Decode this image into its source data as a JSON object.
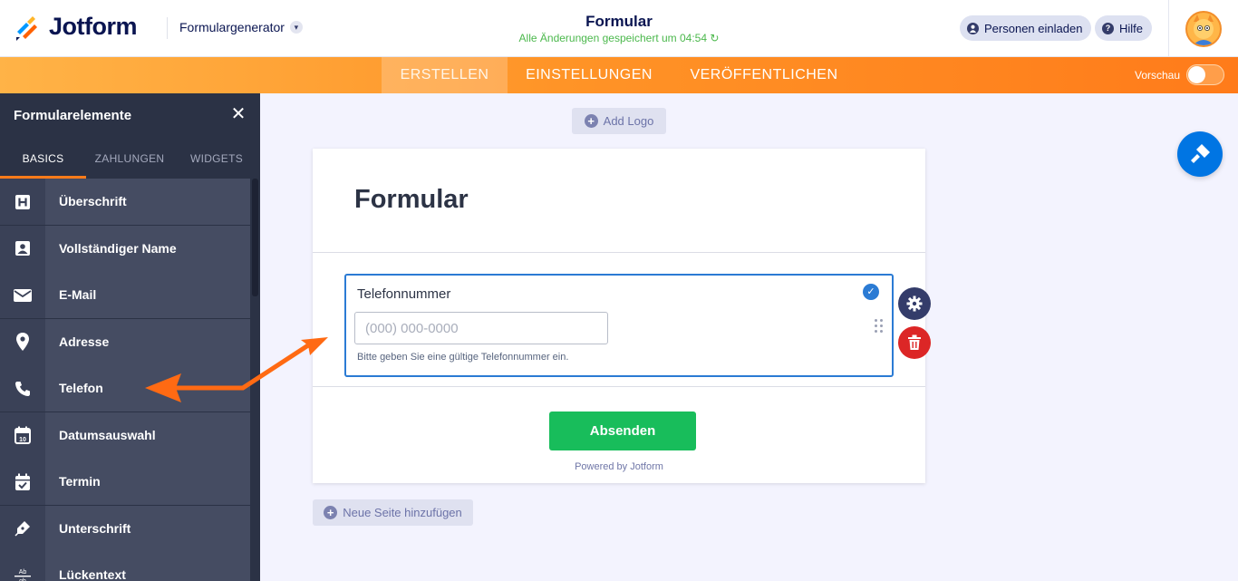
{
  "header": {
    "brand": "Jotform",
    "generator_label": "Formulargenerator",
    "form_title": "Formular",
    "saved_status": "Alle Änderungen gespeichert um 04:54",
    "invite_label": "Personen einladen",
    "help_label": "Hilfe"
  },
  "nav": {
    "tabs": [
      {
        "label": "ERSTELLEN",
        "active": true
      },
      {
        "label": "EINSTELLUNGEN",
        "active": false
      },
      {
        "label": "VERÖFFENTLICHEN",
        "active": false
      }
    ],
    "preview_label": "Vorschau",
    "preview_on": false
  },
  "sidebar": {
    "title": "Formularelemente",
    "tabs": [
      {
        "label": "BASICS",
        "active": true
      },
      {
        "label": "ZAHLUNGEN",
        "active": false
      },
      {
        "label": "WIDGETS",
        "active": false
      }
    ],
    "items": [
      {
        "label": "Überschrift",
        "icon": "heading-icon"
      },
      {
        "label": "Vollständiger Name",
        "icon": "contact-card-icon"
      },
      {
        "label": "E-Mail",
        "icon": "envelope-icon"
      },
      {
        "label": "Adresse",
        "icon": "map-pin-icon"
      },
      {
        "label": "Telefon",
        "icon": "phone-icon"
      },
      {
        "label": "Datumsauswahl",
        "icon": "calendar-icon"
      },
      {
        "label": "Termin",
        "icon": "calendar-check-icon"
      },
      {
        "label": "Unterschrift",
        "icon": "pen-icon"
      },
      {
        "label": "Lückentext",
        "icon": "fill-blank-icon"
      }
    ]
  },
  "canvas": {
    "add_logo_label": "Add Logo",
    "form_heading": "Formular",
    "field": {
      "label": "Telefonnummer",
      "placeholder": "(000) 000-0000",
      "help": "Bitte geben Sie eine gültige Telefonnummer ein."
    },
    "submit_label": "Absenden",
    "powered_by": "Powered by Jotform",
    "new_page_label": "Neue Seite hinzufügen"
  },
  "colors": {
    "brand_navy": "#0a1551",
    "nav_orange": "#ff7b1a",
    "submit_green": "#18bd5b",
    "accent_blue": "#2b7bd4",
    "delete_red": "#dc2626",
    "annotation_arrow": "#ff6a13"
  }
}
